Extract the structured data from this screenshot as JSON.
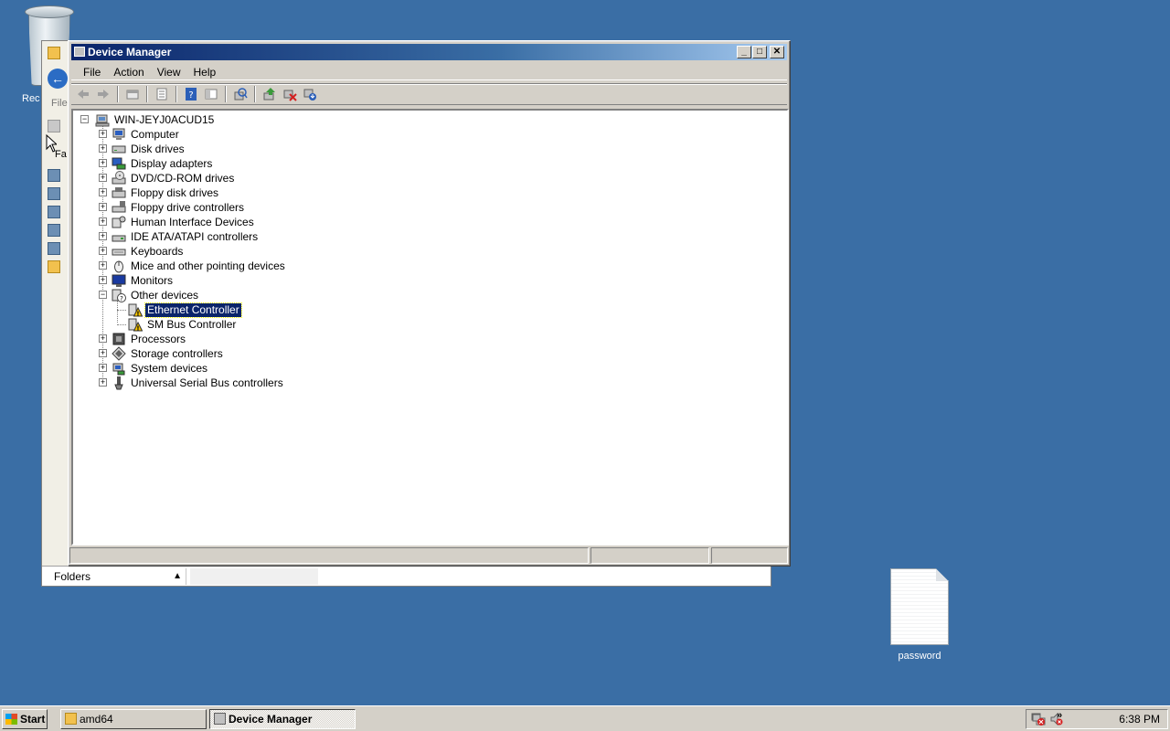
{
  "desktop": {
    "recycle_bin_label": "Rec",
    "file_icon_label": "password"
  },
  "explorer": {
    "file_label": "File",
    "fav_label": "Fa",
    "folders_label": "Folders"
  },
  "device_manager": {
    "title": "Device Manager",
    "menu": [
      "File",
      "Action",
      "View",
      "Help"
    ],
    "toolbar_icons": [
      "back-icon",
      "forward-icon",
      "up-level-icon",
      "properties-icon",
      "help-icon",
      "show-hide-tree-icon",
      "scan-hardware-icon",
      "update-driver-icon",
      "uninstall-icon",
      "disable-icon"
    ],
    "tree": {
      "root": "WIN-JEYJ0ACUD15",
      "categories": [
        {
          "label": "Computer",
          "icon": "computer-icon"
        },
        {
          "label": "Disk drives",
          "icon": "disk-drive-icon"
        },
        {
          "label": "Display adapters",
          "icon": "display-adapter-icon"
        },
        {
          "label": "DVD/CD-ROM drives",
          "icon": "dvd-drive-icon"
        },
        {
          "label": "Floppy disk drives",
          "icon": "floppy-disk-icon"
        },
        {
          "label": "Floppy drive controllers",
          "icon": "floppy-controller-icon"
        },
        {
          "label": "Human Interface Devices",
          "icon": "hid-icon"
        },
        {
          "label": "IDE ATA/ATAPI controllers",
          "icon": "ide-controller-icon"
        },
        {
          "label": "Keyboards",
          "icon": "keyboard-icon"
        },
        {
          "label": "Mice and other pointing devices",
          "icon": "mouse-icon"
        },
        {
          "label": "Monitors",
          "icon": "monitor-icon"
        },
        {
          "label": "Other devices",
          "icon": "unknown-device-icon",
          "expanded": true,
          "children": [
            {
              "label": "Ethernet Controller",
              "icon": "warning-device-icon",
              "selected": true
            },
            {
              "label": "SM Bus Controller",
              "icon": "warning-device-icon"
            }
          ]
        },
        {
          "label": "Processors",
          "icon": "processor-icon"
        },
        {
          "label": "Storage controllers",
          "icon": "storage-controller-icon"
        },
        {
          "label": "System devices",
          "icon": "system-device-icon"
        },
        {
          "label": "Universal Serial Bus controllers",
          "icon": "usb-icon"
        }
      ]
    }
  },
  "taskbar": {
    "start_label": "Start",
    "tasks": [
      {
        "label": "amd64",
        "active": false
      },
      {
        "label": "Device Manager",
        "active": true
      }
    ],
    "clock": "6:38 PM",
    "overflow": "»"
  },
  "colors": {
    "desktop": "#3a6ea5",
    "selection": "#0a246a",
    "title_gradient_start": "#0a246a"
  }
}
